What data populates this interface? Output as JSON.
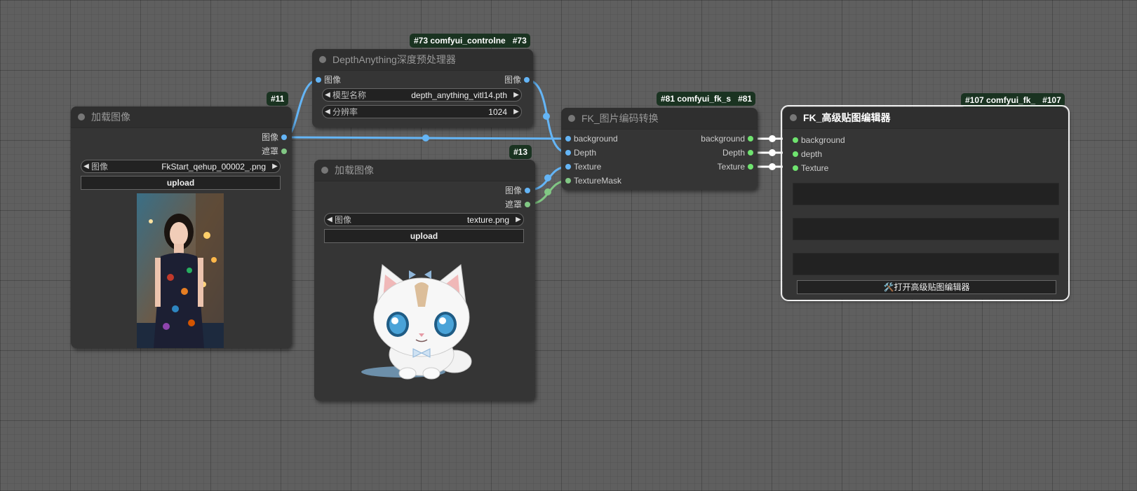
{
  "nodes": {
    "load_image_11": {
      "badge_title": "#11",
      "title": "加载图像",
      "outputs": [
        "图像",
        "遮罩"
      ],
      "image_widget": {
        "label": "图像",
        "value": "FkStart_qehup_00002_.png"
      },
      "upload_label": "upload"
    },
    "depth_73": {
      "badge_title": "#73 comfyui_controlne",
      "badge_id": "#73",
      "title": "DepthAnything深度预处理器",
      "input": "图像",
      "output": "图像",
      "model_widget": {
        "label": "模型名称",
        "value": "depth_anything_vitl14.pth"
      },
      "resolution_widget": {
        "label": "分辨率",
        "value": "1024"
      }
    },
    "load_image_13": {
      "badge_title": "#13",
      "title": "加载图像",
      "outputs": [
        "图像",
        "遮罩"
      ],
      "image_widget": {
        "label": "图像",
        "value": "texture.png"
      },
      "upload_label": "upload"
    },
    "fk_encode_81": {
      "badge_title": "#81 comfyui_fk_s",
      "badge_id": "#81",
      "title": "FK_图片编码转换",
      "inputs": [
        "background",
        "Depth",
        "Texture",
        "TextureMask"
      ],
      "outputs": [
        "background",
        "Depth",
        "Texture"
      ]
    },
    "fk_editor_107": {
      "badge_title": "#107 comfyui_fk_",
      "badge_id": "#107",
      "title": "FK_高级贴图编辑器",
      "inputs": [
        "background",
        "depth",
        "Texture"
      ],
      "open_button_label": "🛠️打开高级贴图编辑器"
    }
  },
  "colors": {
    "canvas": "#5f5f5f",
    "node_body": "#353535",
    "image_link": "#64b5f6",
    "mask_link": "#81c784",
    "green_pin": "#6fe36f",
    "badge": "#1a3321"
  },
  "arrow_icons": {
    "left": "◀",
    "right": "▶"
  }
}
